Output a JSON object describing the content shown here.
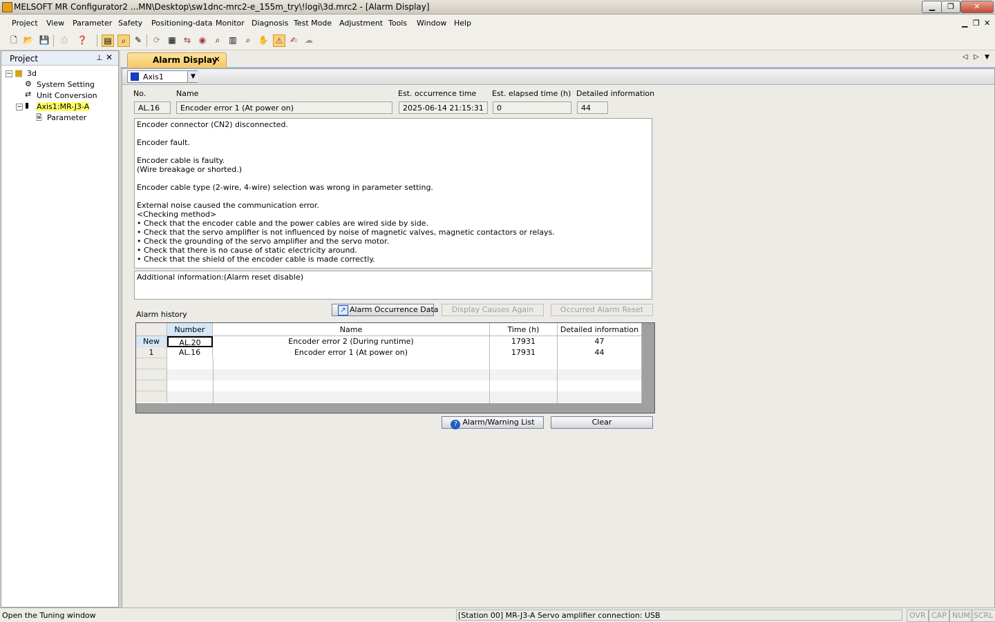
{
  "window": {
    "title": "MELSOFT MR Configurator2 ...MN\\Desktop\\sw1dnc-mrc2-e_155m_try\\!logi\\3d.mrc2 - [Alarm Display]"
  },
  "menu": [
    "Project",
    "View",
    "Parameter",
    "Safety",
    "Positioning-data",
    "Monitor",
    "Diagnosis",
    "Test Mode",
    "Adjustment",
    "Tools",
    "Window",
    "Help"
  ],
  "project_panel": {
    "title": "Project",
    "tree": {
      "root": "3d",
      "system_setting": "System Setting",
      "unit_conversion": "Unit Conversion",
      "axis": "Axis1:MR-J3-A",
      "parameter": "Parameter"
    }
  },
  "tab": {
    "label": "Alarm Display"
  },
  "axis_select": {
    "value": "Axis1"
  },
  "alarm": {
    "labels": {
      "no": "No.",
      "name": "Name",
      "occurrence": "Est. occurrence time",
      "elapsed": "Est. elapsed time (h)",
      "detail": "Detailed information"
    },
    "no": "AL.16",
    "name": "Encoder error 1 (At power on)",
    "occurrence": "2025-06-14 21:15:31",
    "elapsed": "0",
    "detail": "44",
    "cause_lines": [
      "Encoder connector (CN2) disconnected.",
      "",
      "Encoder fault.",
      "",
      "Encoder cable is faulty.",
      "(Wire breakage or shorted.)",
      "",
      "Encoder cable type (2-wire, 4-wire) selection was wrong in parameter setting.",
      "",
      "External noise caused the communication error.",
      "<Checking method>",
      "• Check that the encoder cable and the power cables are wired side by side.",
      "• Check that the servo amplifier is not influenced by noise of magnetic valves, magnetic contactors or relays.",
      "• Check the grounding of the servo amplifier and the servo motor.",
      "• Check that there is no cause of static electricity around.",
      "• Check that the shield of the encoder cable is made correctly."
    ],
    "additional": "Additional information:(Alarm reset disable)"
  },
  "history": {
    "title": "Alarm history",
    "buttons": {
      "occurrence_data": "Alarm Occurrence Data",
      "display_causes": "Display Causes Again",
      "reset": "Occurred Alarm Reset"
    },
    "columns": [
      "Number",
      "Name",
      "Time (h)",
      "Detailed information"
    ],
    "rows": [
      {
        "row": "New",
        "number": "AL.20",
        "name": "Encoder error 2 (During runtime)",
        "time": "17931",
        "detail": "47"
      },
      {
        "row": "1",
        "number": "AL.16",
        "name": "Encoder error 1 (At power on)",
        "time": "17931",
        "detail": "44"
      }
    ]
  },
  "bottom_buttons": {
    "warning_list": "Alarm/Warning List",
    "clear": "Clear"
  },
  "status": {
    "left": "Open the Tuning window",
    "station": "[Station 00] MR-J3-A Servo amplifier connection: USB",
    "indicators": [
      "OVR",
      "CAP",
      "NUM",
      "SCRL"
    ]
  }
}
